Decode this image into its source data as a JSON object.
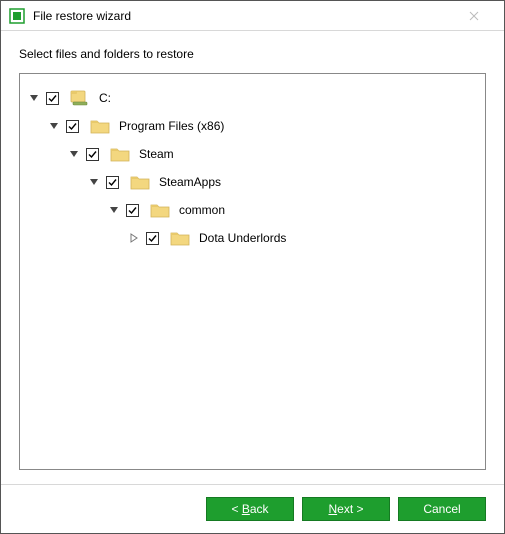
{
  "window": {
    "title": "File restore wizard"
  },
  "instruction": "Select files and folders to restore",
  "tree": {
    "nodes": [
      {
        "label": "C:",
        "depth": 0,
        "expanded": true,
        "checked": true,
        "root": true
      },
      {
        "label": "Program Files (x86)",
        "depth": 1,
        "expanded": true,
        "checked": true
      },
      {
        "label": "Steam",
        "depth": 2,
        "expanded": true,
        "checked": true
      },
      {
        "label": "SteamApps",
        "depth": 3,
        "expanded": true,
        "checked": true
      },
      {
        "label": "common",
        "depth": 4,
        "expanded": true,
        "checked": true
      },
      {
        "label": "Dota Underlords",
        "depth": 5,
        "expanded": false,
        "checked": true
      }
    ]
  },
  "buttons": {
    "back": "< Back",
    "next": "Next >",
    "cancel": "Cancel"
  },
  "colors": {
    "accent": "#1e9e2e",
    "folder": "#f3d77f"
  }
}
